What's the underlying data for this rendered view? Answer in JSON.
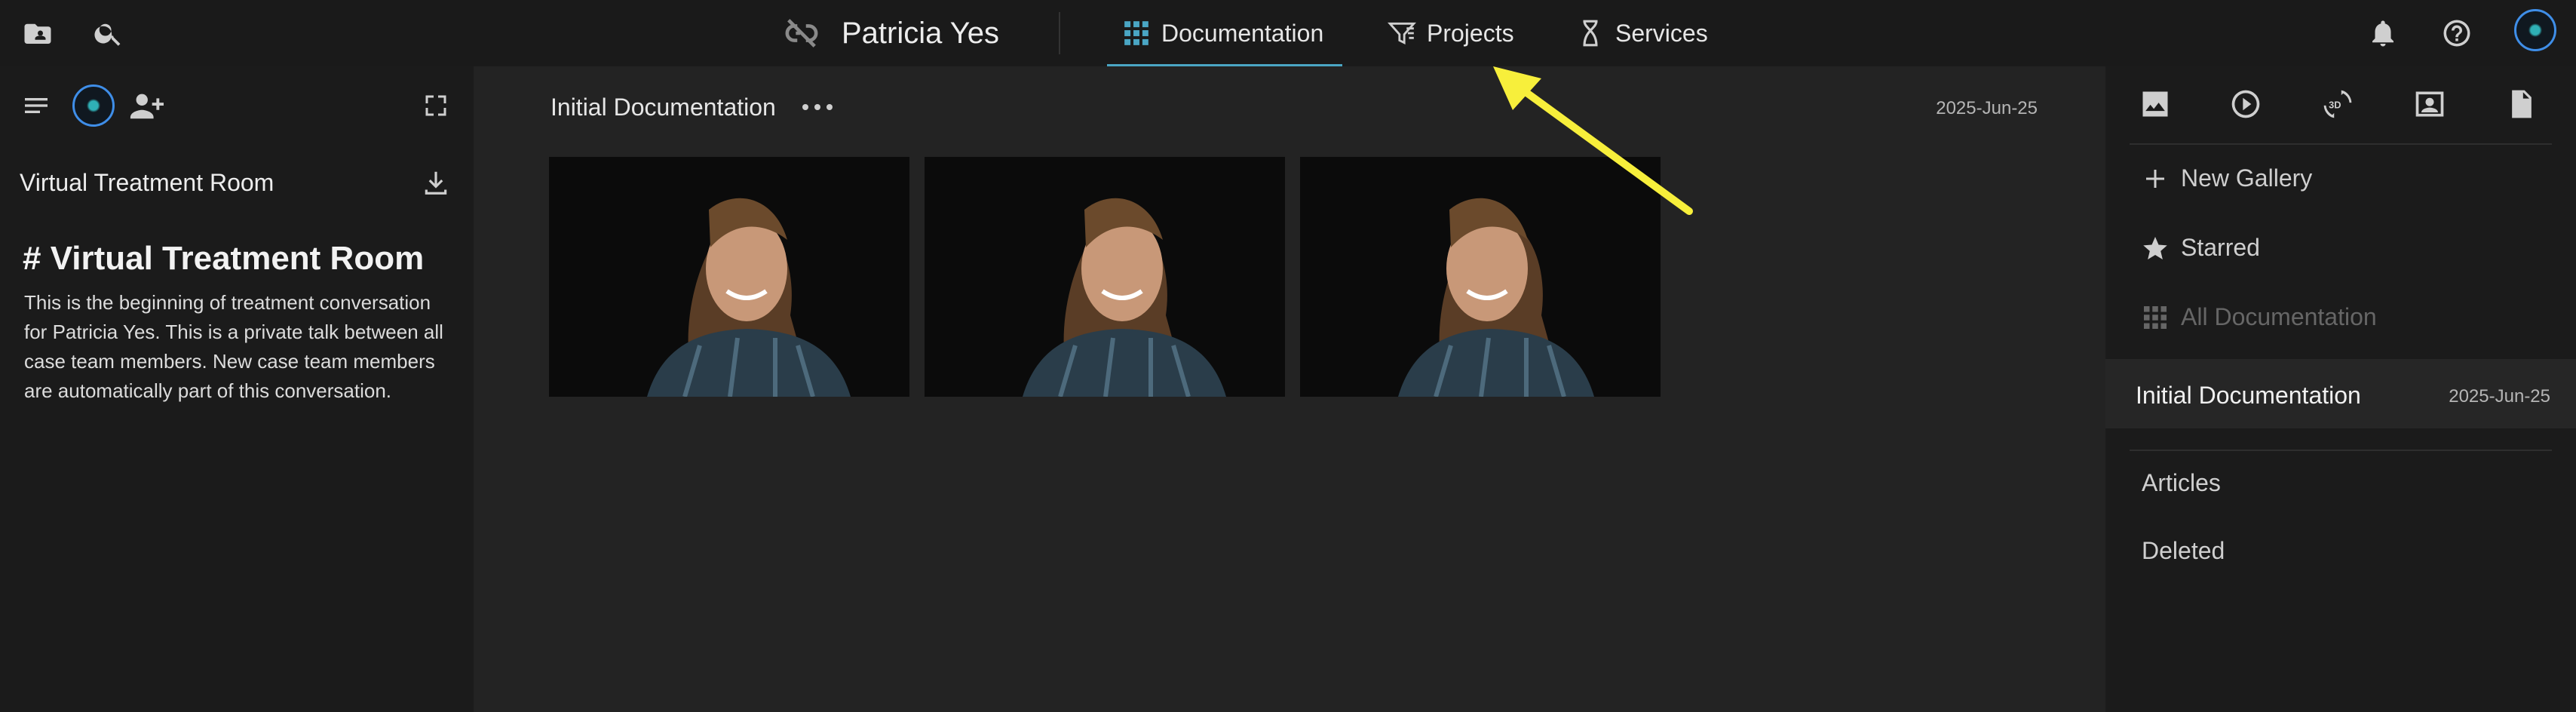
{
  "topbar": {
    "patient_name": "Patricia Yes",
    "tabs": [
      {
        "label": "Documentation",
        "icon": "grid-icon",
        "active": true
      },
      {
        "label": "Projects",
        "icon": "filter-list-icon",
        "active": false
      },
      {
        "label": "Services",
        "icon": "hourglass-icon",
        "active": false
      }
    ],
    "icons": [
      "folder-account-icon",
      "search-icon",
      "link-off-icon",
      "bell-icon",
      "help-icon",
      "avatar"
    ]
  },
  "left_panel": {
    "room_title": "Virtual Treatment Room",
    "heading": "# Virtual Treatment Room",
    "body": "This is the beginning of treatment conversation for Patricia Yes. This is a private talk between all case team members. New case team members are automatically part of this conversation."
  },
  "main": {
    "title": "Initial Documentation",
    "date": "2025-Jun-25",
    "thumbnails": 3
  },
  "right_panel": {
    "tools": [
      "image-icon",
      "play-circle-icon",
      "3d-rotate-icon",
      "portrait-icon",
      "document-icon"
    ],
    "items": [
      {
        "label": "New Gallery",
        "icon": "plus-icon",
        "disabled": false
      },
      {
        "label": "Starred",
        "icon": "star-icon",
        "disabled": false
      },
      {
        "label": "All Documentation",
        "icon": "grid-icon",
        "disabled": true
      }
    ],
    "selected": {
      "title": "Initial Documentation",
      "date": "2025-Jun-25"
    },
    "sections": [
      "Articles",
      "Deleted"
    ]
  },
  "colors": {
    "accent": "#4aa6c4",
    "avatar_ring": "#3f8ee8",
    "annotation": "#f7ef3b",
    "background": "#232323",
    "panel": "#1b1b1b"
  }
}
